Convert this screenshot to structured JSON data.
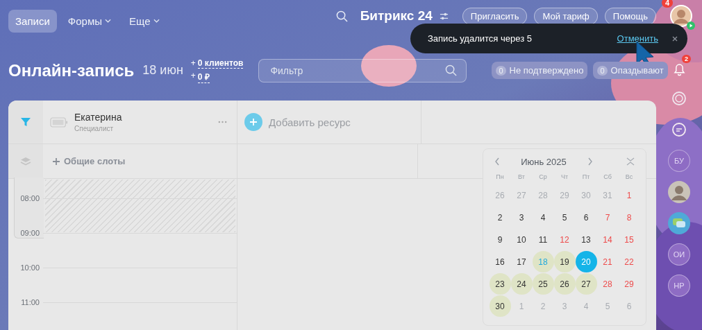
{
  "top_nav": [
    {
      "label": "Записи",
      "selected": true,
      "dropdown": false
    },
    {
      "label": "Формы",
      "selected": false,
      "dropdown": true
    },
    {
      "label": "Еще",
      "selected": false,
      "dropdown": true
    }
  ],
  "brand": "Битрикс 24",
  "header_buttons": [
    "Пригласить",
    "Мой тариф",
    "Помощь"
  ],
  "notifications_badge": "4",
  "toast": {
    "message": "Запись удалится через 5",
    "action": "Отменить"
  },
  "page": {
    "title": "Онлайн-запись",
    "date": "18 июн",
    "stats": [
      {
        "prefix": "+",
        "value": "0 клиентов"
      },
      {
        "prefix": "+",
        "value": "0 ₽"
      }
    ]
  },
  "filter": {
    "placeholder": "Фильтр"
  },
  "counters": [
    {
      "count": "0",
      "label": "Не подтверждено"
    },
    {
      "count": "0",
      "label": "Опаздывают"
    }
  ],
  "right_sidebar": {
    "bell_badge": "2",
    "items": [
      {
        "kind": "ring"
      },
      {
        "kind": "chat-ring"
      },
      {
        "kind": "initials",
        "text": "БУ"
      },
      {
        "kind": "avatar"
      },
      {
        "kind": "chat"
      },
      {
        "kind": "initials",
        "text": "ОИ"
      },
      {
        "kind": "initials",
        "text": "НР"
      }
    ]
  },
  "schedule": {
    "resources": [
      {
        "name": "Екатерина",
        "role": "Специалист"
      }
    ],
    "add_resource": "Добавить ресурс",
    "shared_slots": "Общие слоты",
    "times": [
      "08:00",
      "09:00",
      "10:00",
      "11:00"
    ]
  },
  "calendar": {
    "title": "Июнь 2025",
    "weekdays": [
      "Пн",
      "Вт",
      "Ср",
      "Чт",
      "Пт",
      "Сб",
      "Вс"
    ],
    "weeks": [
      [
        {
          "day": "26",
          "other_month": true,
          "weekend": false,
          "highlighted": false,
          "today": false,
          "selected": false
        },
        {
          "day": "27",
          "other_month": true,
          "weekend": false,
          "highlighted": false,
          "today": false,
          "selected": false
        },
        {
          "day": "28",
          "other_month": true,
          "weekend": false,
          "highlighted": false,
          "today": false,
          "selected": false
        },
        {
          "day": "29",
          "other_month": true,
          "weekend": false,
          "highlighted": false,
          "today": false,
          "selected": false
        },
        {
          "day": "30",
          "other_month": true,
          "weekend": false,
          "highlighted": false,
          "today": false,
          "selected": false
        },
        {
          "day": "31",
          "other_month": true,
          "weekend": false,
          "highlighted": false,
          "today": false,
          "selected": false
        },
        {
          "day": "1",
          "other_month": false,
          "weekend": true,
          "highlighted": false,
          "today": false,
          "selected": false
        }
      ],
      [
        {
          "day": "2",
          "other_month": false,
          "weekend": false,
          "highlighted": false,
          "today": false,
          "selected": false
        },
        {
          "day": "3",
          "other_month": false,
          "weekend": false,
          "highlighted": false,
          "today": false,
          "selected": false
        },
        {
          "day": "4",
          "other_month": false,
          "weekend": false,
          "highlighted": false,
          "today": false,
          "selected": false
        },
        {
          "day": "5",
          "other_month": false,
          "weekend": false,
          "highlighted": false,
          "today": false,
          "selected": false
        },
        {
          "day": "6",
          "other_month": false,
          "weekend": false,
          "highlighted": false,
          "today": false,
          "selected": false
        },
        {
          "day": "7",
          "other_month": false,
          "weekend": true,
          "highlighted": false,
          "today": false,
          "selected": false
        },
        {
          "day": "8",
          "other_month": false,
          "weekend": true,
          "highlighted": false,
          "today": false,
          "selected": false
        }
      ],
      [
        {
          "day": "9",
          "other_month": false,
          "weekend": false,
          "highlighted": false,
          "today": false,
          "selected": false
        },
        {
          "day": "10",
          "other_month": false,
          "weekend": false,
          "highlighted": false,
          "today": false,
          "selected": false
        },
        {
          "day": "11",
          "other_month": false,
          "weekend": false,
          "highlighted": false,
          "today": false,
          "selected": false
        },
        {
          "day": "12",
          "other_month": false,
          "weekend": true,
          "highlighted": false,
          "today": false,
          "selected": false
        },
        {
          "day": "13",
          "other_month": false,
          "weekend": false,
          "highlighted": false,
          "today": false,
          "selected": false
        },
        {
          "day": "14",
          "other_month": false,
          "weekend": true,
          "highlighted": false,
          "today": false,
          "selected": false
        },
        {
          "day": "15",
          "other_month": false,
          "weekend": true,
          "highlighted": false,
          "today": false,
          "selected": false
        }
      ],
      [
        {
          "day": "16",
          "other_month": false,
          "weekend": false,
          "highlighted": false,
          "today": false,
          "selected": false
        },
        {
          "day": "17",
          "other_month": false,
          "weekend": false,
          "highlighted": false,
          "today": false,
          "selected": false
        },
        {
          "day": "18",
          "other_month": false,
          "weekend": false,
          "highlighted": true,
          "today": true,
          "selected": false
        },
        {
          "day": "19",
          "other_month": false,
          "weekend": false,
          "highlighted": true,
          "today": false,
          "selected": false
        },
        {
          "day": "20",
          "other_month": false,
          "weekend": false,
          "highlighted": false,
          "today": false,
          "selected": true
        },
        {
          "day": "21",
          "other_month": false,
          "weekend": true,
          "highlighted": false,
          "today": false,
          "selected": false
        },
        {
          "day": "22",
          "other_month": false,
          "weekend": true,
          "highlighted": false,
          "today": false,
          "selected": false
        }
      ],
      [
        {
          "day": "23",
          "other_month": false,
          "weekend": false,
          "highlighted": true,
          "today": false,
          "selected": false
        },
        {
          "day": "24",
          "other_month": false,
          "weekend": false,
          "highlighted": true,
          "today": false,
          "selected": false
        },
        {
          "day": "25",
          "other_month": false,
          "weekend": false,
          "highlighted": true,
          "today": false,
          "selected": false
        },
        {
          "day": "26",
          "other_month": false,
          "weekend": false,
          "highlighted": true,
          "today": false,
          "selected": false
        },
        {
          "day": "27",
          "other_month": false,
          "weekend": false,
          "highlighted": true,
          "today": false,
          "selected": false
        },
        {
          "day": "28",
          "other_month": false,
          "weekend": true,
          "highlighted": false,
          "today": false,
          "selected": false
        },
        {
          "day": "29",
          "other_month": false,
          "weekend": true,
          "highlighted": false,
          "today": false,
          "selected": false
        }
      ],
      [
        {
          "day": "30",
          "other_month": false,
          "weekend": false,
          "highlighted": true,
          "today": false,
          "selected": false
        },
        {
          "day": "1",
          "other_month": true,
          "weekend": false,
          "highlighted": false,
          "today": false,
          "selected": false
        },
        {
          "day": "2",
          "other_month": true,
          "weekend": false,
          "highlighted": false,
          "today": false,
          "selected": false
        },
        {
          "day": "3",
          "other_month": true,
          "weekend": false,
          "highlighted": false,
          "today": false,
          "selected": false
        },
        {
          "day": "4",
          "other_month": true,
          "weekend": false,
          "highlighted": false,
          "today": false,
          "selected": false
        },
        {
          "day": "5",
          "other_month": true,
          "weekend": false,
          "highlighted": false,
          "today": false,
          "selected": false
        },
        {
          "day": "6",
          "other_month": true,
          "weekend": false,
          "highlighted": false,
          "today": false,
          "selected": false
        }
      ]
    ]
  }
}
